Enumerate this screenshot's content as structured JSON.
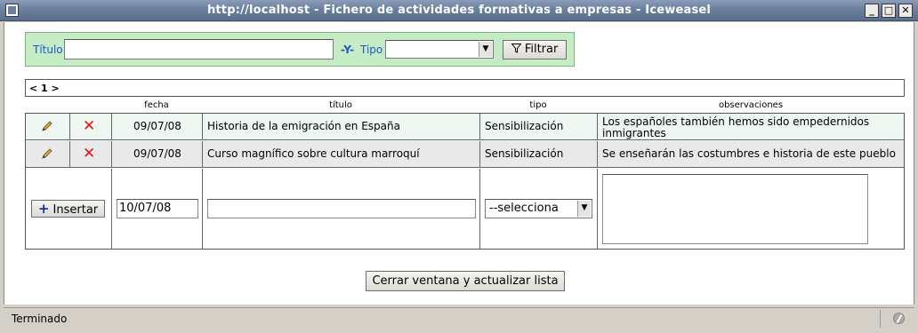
{
  "window": {
    "title": "http://localhost - Fichero de actividades formativas a empresas - Iceweasel",
    "min_glyph": "_",
    "max_glyph": "□",
    "close_glyph": "✕"
  },
  "filter": {
    "title_label": "Título",
    "title_value": "",
    "and_label": "-Y-",
    "type_label": "Tipo",
    "type_value": "",
    "filter_button": "Filtrar",
    "filter_icon": "funnel-icon"
  },
  "pager": {
    "text": "< 1 >"
  },
  "table": {
    "headers": [
      "fecha",
      "título",
      "tipo",
      "observaciones"
    ],
    "rows": [
      {
        "fecha": "09/07/08",
        "titulo": "Historia de la emigración en España",
        "tipo": "Sensibilización",
        "observaciones": "Los españoles también hemos sido empedernidos inmigrantes"
      },
      {
        "fecha": "09/07/08",
        "titulo": "Curso magnífico sobre cultura marroquí",
        "tipo": "Sensibilización",
        "observaciones": "Se enseñarán las costumbres e historia de este pueblo"
      }
    ],
    "row_icons": {
      "edit": "pencil-icon",
      "delete": "red-x-icon"
    }
  },
  "insert": {
    "button": "Insertar",
    "plus_icon": "plus-icon",
    "fecha_value": "10/07/08",
    "titulo_value": "",
    "tipo_selected": "--selecciona",
    "observaciones_value": ""
  },
  "footer_button": "Cerrar ventana y actualizar lista",
  "status": {
    "text": "Terminado",
    "icon": "security-status-icon"
  },
  "colors": {
    "filter_bg": "#c6ecc6",
    "label_blue": "#2255cc",
    "delete_red": "#e01515",
    "titlebar": "#6b7f9f"
  }
}
